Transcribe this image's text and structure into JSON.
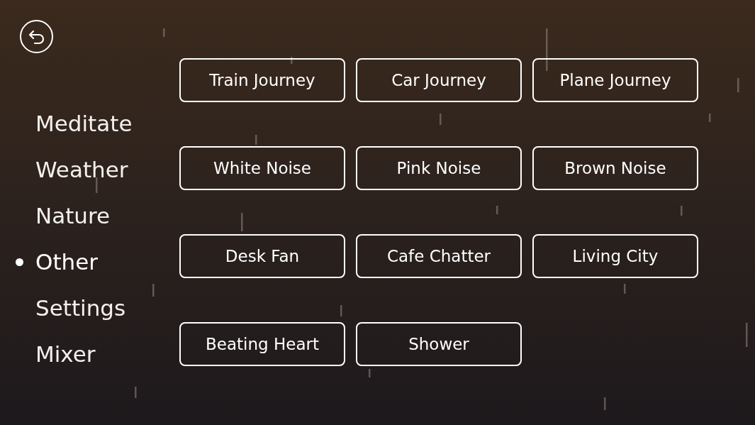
{
  "nav": [
    {
      "label": "Meditate",
      "selected": false
    },
    {
      "label": "Weather",
      "selected": false
    },
    {
      "label": "Nature",
      "selected": false
    },
    {
      "label": "Other",
      "selected": true
    },
    {
      "label": "Settings",
      "selected": false
    },
    {
      "label": "Mixer",
      "selected": false
    }
  ],
  "sounds": [
    "Train Journey",
    "Car Journey",
    "Plane Journey",
    "White Noise",
    "Pink Noise",
    "Brown Noise",
    "Desk Fan",
    "Cafe Chatter",
    "Living City",
    "Beating Heart",
    "Shower"
  ]
}
